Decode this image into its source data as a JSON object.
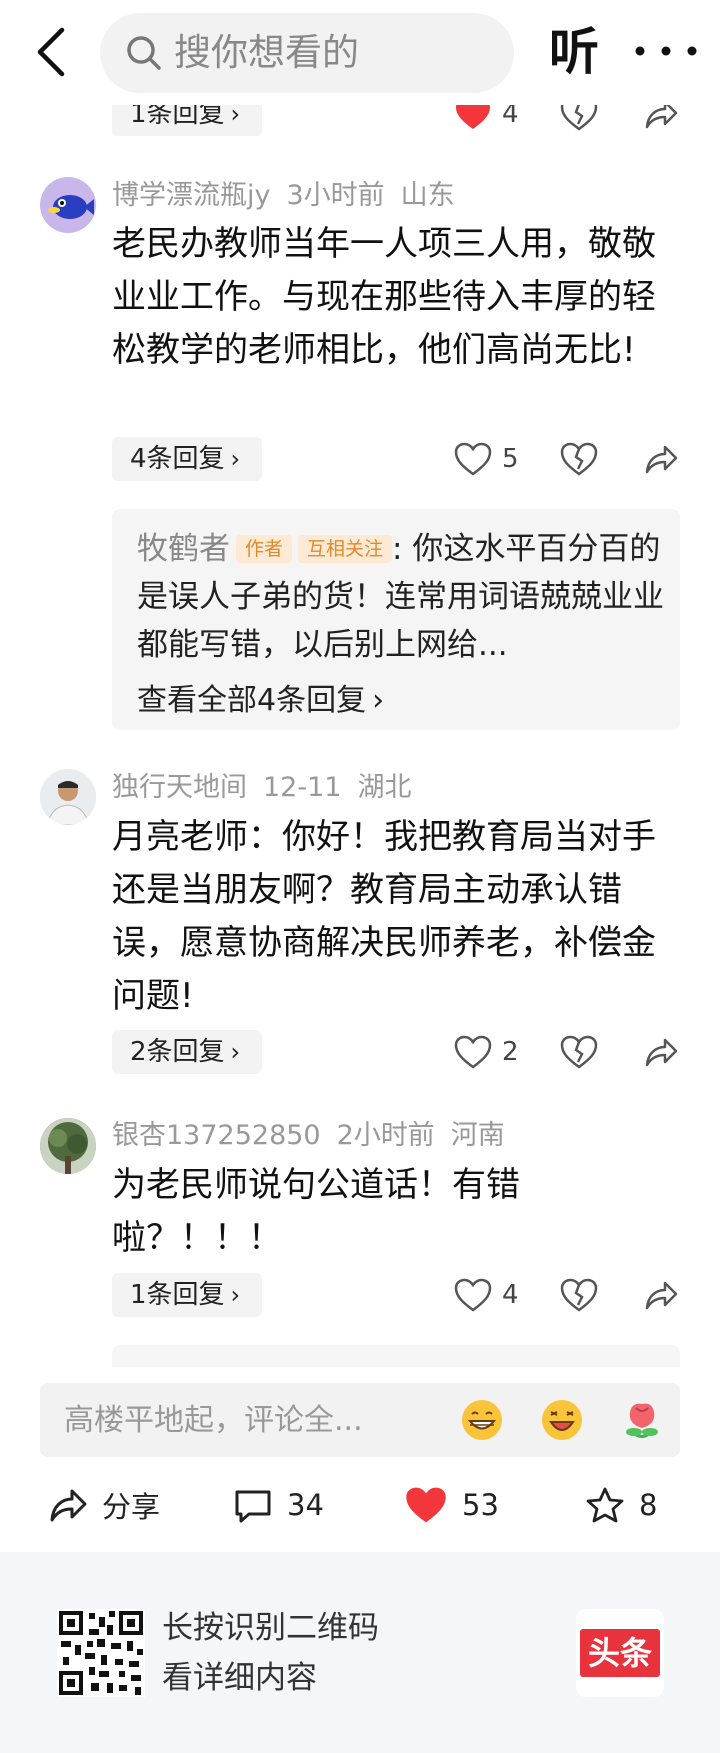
{
  "header": {
    "search_placeholder": "搜你想看的",
    "listen_label": "听"
  },
  "partial_top": {
    "reply_label": "1条回复",
    "like_count": "4"
  },
  "comments": [
    {
      "author": "博学漂流瓶jy",
      "time": "3小时前",
      "location": "山东",
      "text": "老民办教师当年一人项三人用，敬敬业业工作。与现在那些待入丰厚的轻松教学的老师相比，他们高尚无比!",
      "reply_label": "4条回复",
      "like_count": "5",
      "reply_preview": {
        "author": "牧鹤者",
        "tag_author": "作者",
        "tag_mutual": "互相关注",
        "text": ": 你这水平百分百的是误人子弟的货！连常用词语兢兢业业都能写错，以后别上网给...",
        "view_all": "查看全部4条回复"
      }
    },
    {
      "author": "独行天地间",
      "time": "12-11",
      "location": "湖北",
      "text": "月亮老师：你好！我把教育局当对手还是当朋友啊？教育局主动承认错误，愿意协商解决民师养老，补偿金问题!",
      "reply_label": "2条回复",
      "like_count": "2"
    },
    {
      "author": "银杏137252850",
      "time": "2小时前",
      "location": "河南",
      "text": "为老民师说句公道话！有错啦？！！！",
      "reply_label": "1条回复",
      "like_count": "4"
    }
  ],
  "input_bar": {
    "placeholder": "高楼平地起，评论全..."
  },
  "toolbar": {
    "share_label": "分享",
    "comment_count": "34",
    "like_count": "53",
    "favorite_count": "8"
  },
  "footer": {
    "line1": "长按识别二维码",
    "line2": "看详细内容",
    "brand": "头条"
  },
  "colors": {
    "like_red": "#f2363c",
    "tag_bg": "#fde9d4",
    "tag_text": "#e08a2a",
    "brand_red": "#e8323c"
  }
}
